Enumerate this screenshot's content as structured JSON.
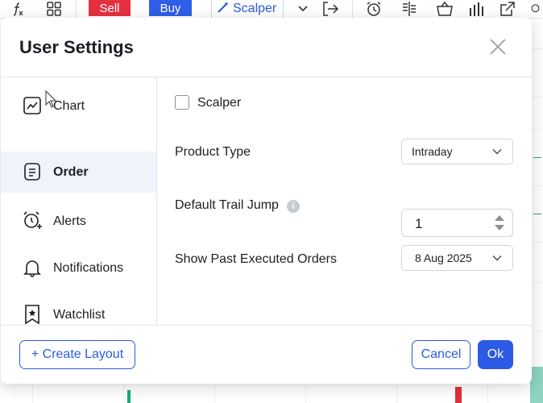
{
  "toolbar": {
    "fx_icon": "function-icon",
    "grid_icon": "grid-icon",
    "sell_label": "Sell",
    "buy_label": "Buy",
    "scalper_label": "Scalper",
    "icons": [
      "chevron-down-icon",
      "exit-icon",
      "alarm-icon",
      "ladder-icon",
      "basket-icon",
      "bar-chart-icon",
      "external-link-icon",
      "search-icon"
    ]
  },
  "modal": {
    "title": "User Settings",
    "close_icon": "close-icon"
  },
  "sidebar": {
    "items": [
      {
        "label": "Chart",
        "icon": "chart-icon",
        "active": false
      },
      {
        "label": "Order",
        "icon": "order-icon",
        "active": true
      },
      {
        "label": "Alerts",
        "icon": "alarm-add-icon",
        "active": false
      },
      {
        "label": "Notifications",
        "icon": "bell-icon",
        "active": false
      },
      {
        "label": "Watchlist",
        "icon": "bookmark-star-icon",
        "active": false
      }
    ]
  },
  "order_settings": {
    "scalper_label": "Scalper",
    "scalper_checked": false,
    "product_type_label": "Product Type",
    "product_type_value": "Intraday",
    "trail_jump_label": "Default Trail Jump",
    "trail_jump_value": "1",
    "info_icon": "info-icon",
    "past_orders_label": "Show Past Executed Orders",
    "past_orders_value": "8 Aug 2025"
  },
  "footer": {
    "create_layout_label": "+ Create Layout",
    "cancel_label": "Cancel",
    "ok_label": "Ok"
  },
  "colors": {
    "accent": "#2b5be5",
    "sell": "#e5313e",
    "buy": "#2f5ee8",
    "active_bg": "#f0f3f9"
  }
}
